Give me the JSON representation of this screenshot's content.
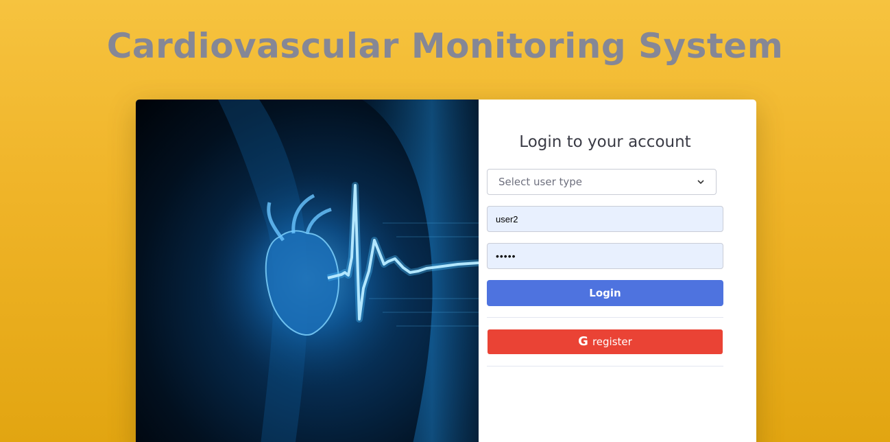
{
  "header": {
    "title": "Cardiovascular Monitoring System"
  },
  "hero": {
    "icon": "heart-ecg-image"
  },
  "login_form": {
    "heading": "Login to your account",
    "user_type_select": {
      "selected": "Select user type"
    },
    "username": {
      "value": "user2"
    },
    "password": {
      "value": "•••••"
    },
    "login_label": "Login",
    "register_label": "register",
    "register_icon": "google-icon"
  },
  "colors": {
    "background": "#f0b52a",
    "title": "#858796",
    "login_button": "#4e73df",
    "register_button": "#ea4335",
    "input_fill": "#e8f0fe"
  }
}
